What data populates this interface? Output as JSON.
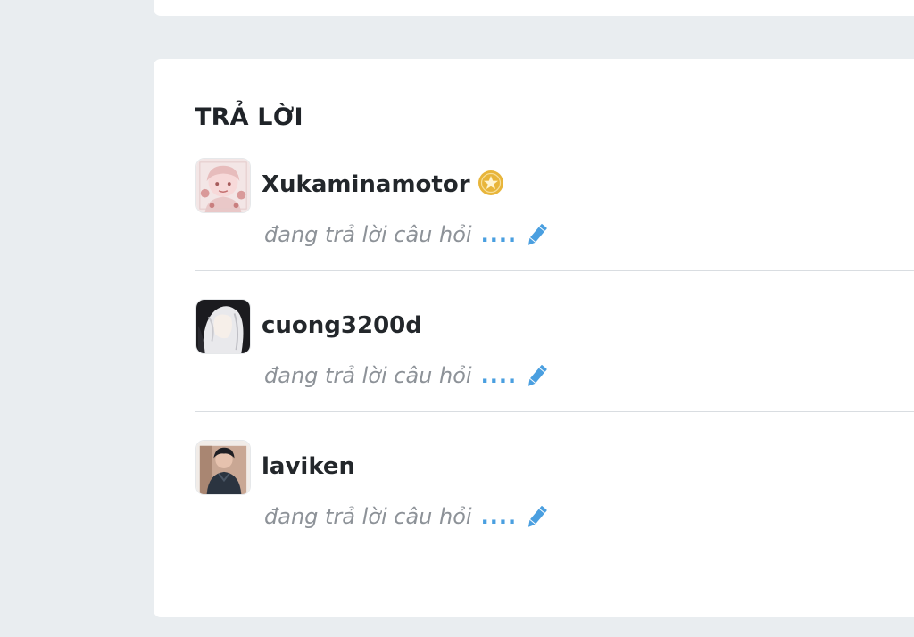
{
  "section": {
    "title": "TRẢ LỜI"
  },
  "answers": [
    {
      "username": "Xukaminamotor",
      "verified": true,
      "status": "đang trả lời câu hỏi",
      "dots": "....",
      "avatar": "anime-girl-avatar"
    },
    {
      "username": "cuong3200d",
      "verified": false,
      "status": "đang trả lời câu hỏi",
      "dots": "....",
      "avatar": "white-hair-character-avatar"
    },
    {
      "username": "laviken",
      "verified": false,
      "status": "đang trả lời câu hỏi",
      "dots": "....",
      "avatar": "person-photo-avatar"
    }
  ],
  "colors": {
    "page_background": "#e9edf0",
    "card_background": "#ffffff",
    "accent_blue": "#4a9fe0",
    "badge_gold": "#e8b53a",
    "muted_text": "#8d9298"
  },
  "icons": {
    "pencil": "pencil-icon",
    "badge": "verified-badge-icon"
  }
}
